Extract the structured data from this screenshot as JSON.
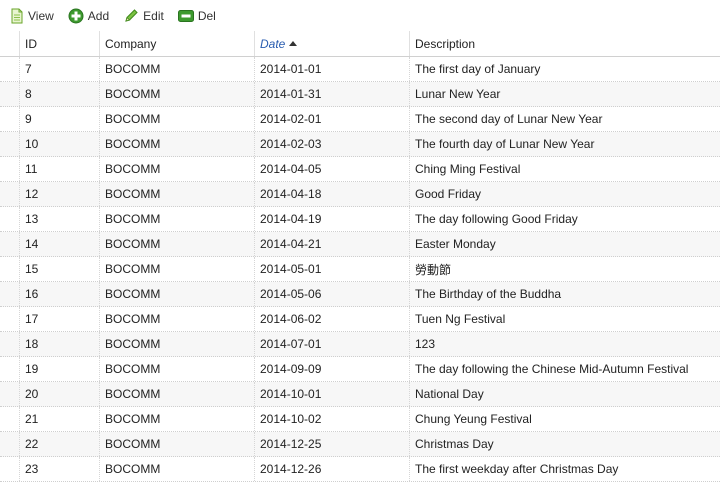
{
  "toolbar": {
    "view_label": "View",
    "add_label": "Add",
    "edit_label": "Edit",
    "del_label": "Del",
    "icons": {
      "view": "document-icon",
      "add": "plus-icon",
      "edit": "pencil-icon",
      "del": "minus-icon"
    }
  },
  "table": {
    "columns": {
      "id": "ID",
      "company": "Company",
      "date": "Date",
      "description": "Description"
    },
    "sort": {
      "column": "Date",
      "direction": "ascending"
    },
    "rows": [
      {
        "id": "7",
        "company": "BOCOMM",
        "date": "2014-01-01",
        "description": "The first day of January"
      },
      {
        "id": "8",
        "company": "BOCOMM",
        "date": "2014-01-31",
        "description": "Lunar New Year"
      },
      {
        "id": "9",
        "company": "BOCOMM",
        "date": "2014-02-01",
        "description": "The second day of Lunar New Year"
      },
      {
        "id": "10",
        "company": "BOCOMM",
        "date": "2014-02-03",
        "description": "The fourth day of Lunar New Year"
      },
      {
        "id": "11",
        "company": "BOCOMM",
        "date": "2014-04-05",
        "description": "Ching Ming Festival"
      },
      {
        "id": "12",
        "company": "BOCOMM",
        "date": "2014-04-18",
        "description": "Good Friday"
      },
      {
        "id": "13",
        "company": "BOCOMM",
        "date": "2014-04-19",
        "description": "The day following Good Friday"
      },
      {
        "id": "14",
        "company": "BOCOMM",
        "date": "2014-04-21",
        "description": "Easter Monday"
      },
      {
        "id": "15",
        "company": "BOCOMM",
        "date": "2014-05-01",
        "description": "勞動節"
      },
      {
        "id": "16",
        "company": "BOCOMM",
        "date": "2014-05-06",
        "description": "The Birthday of the Buddha"
      },
      {
        "id": "17",
        "company": "BOCOMM",
        "date": "2014-06-02",
        "description": "Tuen Ng Festival"
      },
      {
        "id": "18",
        "company": "BOCOMM",
        "date": "2014-07-01",
        "description": "123"
      },
      {
        "id": "19",
        "company": "BOCOMM",
        "date": "2014-09-09",
        "description": "The day following the Chinese Mid-Autumn Festival"
      },
      {
        "id": "20",
        "company": "BOCOMM",
        "date": "2014-10-01",
        "description": "National Day"
      },
      {
        "id": "21",
        "company": "BOCOMM",
        "date": "2014-10-02",
        "description": "Chung Yeung Festival"
      },
      {
        "id": "22",
        "company": "BOCOMM",
        "date": "2014-12-25",
        "description": "Christmas Day"
      },
      {
        "id": "23",
        "company": "BOCOMM",
        "date": "2014-12-26",
        "description": "The first weekday after Christmas Day"
      }
    ]
  }
}
